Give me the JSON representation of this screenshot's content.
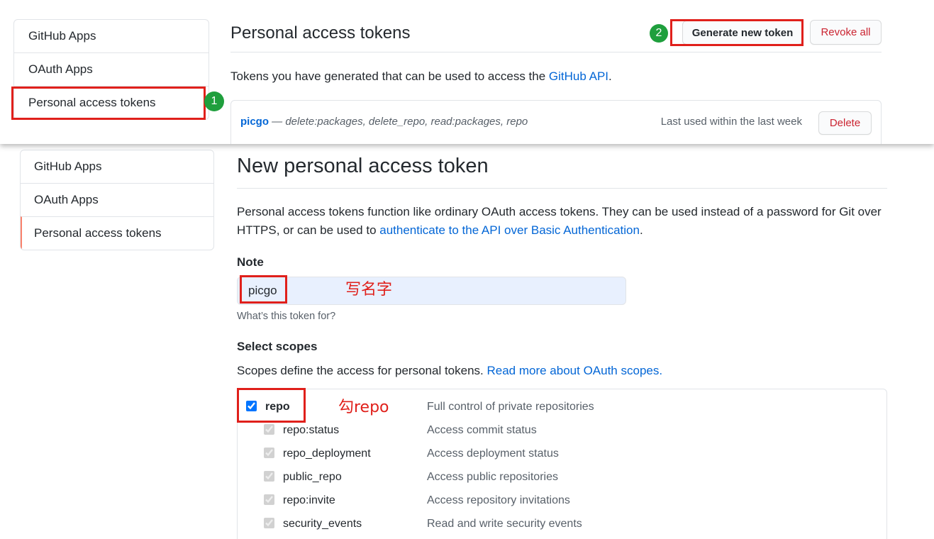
{
  "colors": {
    "link": "#0366d6",
    "danger": "#cb2431",
    "annotation": "#e0201b",
    "marker": "#1f9f3d",
    "selected_indicator": "#f9826c",
    "input_background": "#e8f0fe"
  },
  "annotations": {
    "step_1": "1",
    "step_2": "2",
    "note_hint": "写名字",
    "scope_hint": "勾repo"
  },
  "top_panel": {
    "sidebar": {
      "items": [
        {
          "label": "GitHub Apps"
        },
        {
          "label": "OAuth Apps"
        },
        {
          "label": "Personal access tokens"
        }
      ]
    },
    "title": "Personal access tokens",
    "generate_button": "Generate new token",
    "revoke_all_button": "Revoke all",
    "intro": {
      "text": "Tokens you have generated that can be used to access the ",
      "link": "GitHub API",
      "suffix": "."
    },
    "token": {
      "name": "picgo",
      "scopes": "— delete:packages, delete_repo, read:packages, repo",
      "last_used": "Last used within the last week",
      "delete_button": "Delete"
    }
  },
  "bottom_panel": {
    "sidebar": {
      "items": [
        {
          "label": "GitHub Apps"
        },
        {
          "label": "OAuth Apps"
        },
        {
          "label": "Personal access tokens",
          "selected": true
        }
      ]
    },
    "title": "New personal access token",
    "intro": {
      "text": "Personal access tokens function like ordinary OAuth access tokens. They can be used instead of a password for Git over HTTPS, or can be used to ",
      "link": "authenticate to the API over Basic Authentication",
      "suffix": "."
    },
    "note": {
      "label": "Note",
      "value": "picgo",
      "help": "What’s this token for?"
    },
    "scopes": {
      "heading": "Select scopes",
      "intro": "Scopes define the access for personal tokens. ",
      "link": "Read more about OAuth scopes.",
      "items": [
        {
          "name": "repo",
          "description": "Full control of private repositories",
          "checked": true,
          "disabled": false
        },
        {
          "name": "repo:status",
          "description": "Access commit status",
          "checked": true,
          "disabled": true
        },
        {
          "name": "repo_deployment",
          "description": "Access deployment status",
          "checked": true,
          "disabled": true
        },
        {
          "name": "public_repo",
          "description": "Access public repositories",
          "checked": true,
          "disabled": true
        },
        {
          "name": "repo:invite",
          "description": "Access repository invitations",
          "checked": true,
          "disabled": true
        },
        {
          "name": "security_events",
          "description": "Read and write security events",
          "checked": true,
          "disabled": true
        }
      ]
    }
  }
}
